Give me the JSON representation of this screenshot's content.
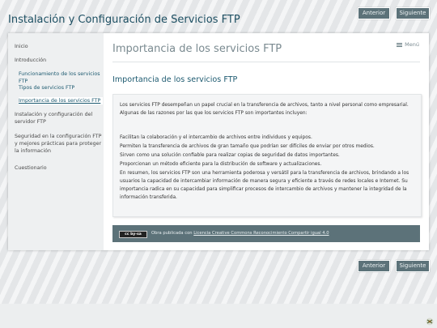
{
  "site": {
    "title": "Instalación y Configuración de Servicios FTP"
  },
  "nav": {
    "prev_label": "Anterior",
    "next_label": "Siguiente"
  },
  "sidebar": {
    "items": [
      {
        "label": "Inicio"
      },
      {
        "label": "Introducción"
      },
      {
        "label": "Funcionamiento de los servicios FTP"
      },
      {
        "label": "Tipos de servicios FTP"
      },
      {
        "label": "Importancia de los servicios FTP"
      },
      {
        "label": "Instalación y configuración del servidor FTP"
      },
      {
        "label": "Seguridad en la configuración FTP y mejores prácticas para proteger la información"
      },
      {
        "label": "Cuestionario"
      }
    ]
  },
  "main": {
    "title": "Importancia de los servicios FTP",
    "menu_label": "Menú",
    "section_title": "Importancia de los servicios FTP",
    "paragraph1": "Los servicios FTP desempeñan un papel crucial en la transferencia de archivos, tanto a nivel personal como empresarial. Algunas de las razones por las que los servicios FTP son importantes incluyen:",
    "lines": [
      "Facilitan la colaboración y el intercambio de archivos entre individuos y equipos.",
      "Permiten la transferencia de archivos de gran tamaño que podrían ser difíciles de enviar por otros medios.",
      "Sirven como una solución confiable para realizar copias de seguridad de datos importantes.",
      "Proporcionan un método eficiente para la distribución de software y actualizaciones."
    ],
    "conclusion": "En resumen, los servicios FTP son una herramienta poderosa y versátil para la transferencia de archivos, brindando a los usuarios la capacidad de intercambiar información de manera segura y eficiente a través de redes locales e Internet. Su importancia radica en su capacidad para simplificar procesos de intercambio de archivos y mantener la integridad de la información transferida."
  },
  "footer": {
    "badge": "cc by-sa",
    "text": "Obra publicada con",
    "license_link": "Licencia Creative Commons Reconocimiento Compartir igual 4.0"
  },
  "icons": {
    "corner": "exelearning-icon",
    "menu": "hamburger-icon"
  }
}
